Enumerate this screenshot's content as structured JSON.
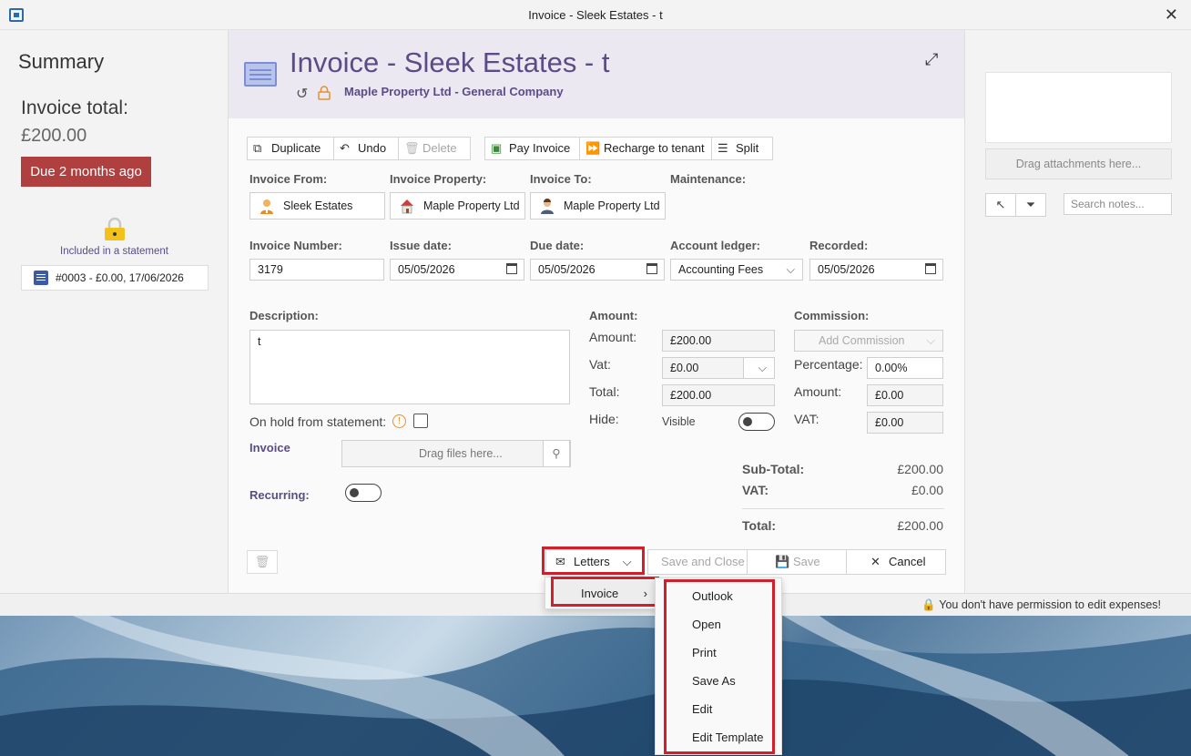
{
  "window": {
    "title": "Invoice - Sleek Estates - t",
    "close": "✕"
  },
  "summary": {
    "heading": "Summary",
    "total_label": "Invoice total:",
    "total_value": "£200.00",
    "due_badge": "Due 2 months ago",
    "statement_label": "Included in a statement",
    "statement_item": "#0003 - £0.00, 17/06/2026"
  },
  "header": {
    "title": "Invoice - Sleek Estates - t",
    "company": "Maple Property Ltd - General Company"
  },
  "toolbar": {
    "duplicate": "Duplicate",
    "undo": "Undo",
    "delete": "Delete",
    "pay_invoice": "Pay Invoice",
    "recharge": "Recharge to tenant",
    "split": "Split"
  },
  "form": {
    "invoice_from_label": "Invoice From:",
    "invoice_from": "Sleek Estates",
    "invoice_property_label": "Invoice Property:",
    "invoice_property": "Maple Property Ltd",
    "invoice_to_label": "Invoice To:",
    "invoice_to": "Maple Property Ltd",
    "maintenance_label": "Maintenance:",
    "invoice_number_label": "Invoice Number:",
    "invoice_number": "3179",
    "issue_date_label": "Issue date:",
    "issue_date": "05/05/2026",
    "due_date_label": "Due date:",
    "due_date": "05/05/2026",
    "account_ledger_label": "Account ledger:",
    "account_ledger": "Accounting Fees",
    "recorded_label": "Recorded:",
    "recorded": "05/05/2026",
    "description_label": "Description:",
    "description": "t",
    "on_hold_label": "On hold from statement:",
    "invoice_label": "Invoice",
    "drag_files": "Drag files here...",
    "recurring_label": "Recurring:"
  },
  "amount": {
    "heading": "Amount:",
    "amount_label": "Amount:",
    "amount": "£200.00",
    "vat_label": "Vat:",
    "vat": "£0.00",
    "total_label": "Total:",
    "total": "£200.00",
    "hide_label": "Hide:",
    "hide_value": "Visible"
  },
  "commission": {
    "heading": "Commission:",
    "add": "Add Commission",
    "percentage_label": "Percentage:",
    "percentage": "0.00%",
    "amount_label": "Amount:",
    "amount": "£0.00",
    "vat_label": "VAT:",
    "vat": "£0.00"
  },
  "totals": {
    "subtotal_label": "Sub-Total:",
    "subtotal": "£200.00",
    "vat_label": "VAT:",
    "vat": "£0.00",
    "total_label": "Total:",
    "total": "£200.00"
  },
  "footer": {
    "letters": "Letters",
    "save_close": "Save and Close",
    "save": "Save",
    "cancel": "Cancel"
  },
  "letters_menu": {
    "submenu": "Invoice",
    "items": [
      "Outlook",
      "Open",
      "Print",
      "Save As",
      "Edit",
      "Edit Template"
    ]
  },
  "right": {
    "drag_attachments": "Drag attachments here...",
    "search_placeholder": "Search notes..."
  },
  "status": {
    "message": "You don't have permission to edit expenses!"
  },
  "colors": {
    "accent": "#5a4c86",
    "due": "#b0403f",
    "highlight": "#d21f2c",
    "lock": "#e5912f"
  }
}
